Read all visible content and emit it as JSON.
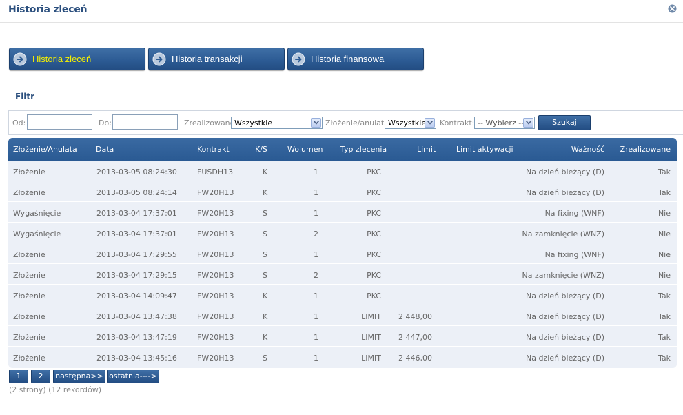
{
  "header": {
    "title": "Historia zleceń",
    "close_icon": "close-circle-icon"
  },
  "tabs": [
    {
      "label": "Historia zleceń",
      "active": true
    },
    {
      "label": "Historia transakcji",
      "active": false
    },
    {
      "label": "Historia finansowa",
      "active": false
    }
  ],
  "filter": {
    "title": "Filtr",
    "od_label": "Od:",
    "od_value": "",
    "do_label": "Do:",
    "do_value": "",
    "zrealizowane_label": "Zrealizowane",
    "zrealizowane_value": "Wszystkie",
    "zlozenie_label": "Złożenie/anulata",
    "zlozenie_value": "Wszystkie",
    "kontrakt_label": "Kontrakt:",
    "kontrakt_value": "-- Wybierz --",
    "search_label": "Szukaj"
  },
  "table": {
    "columns": [
      "Złożenie/Anulata",
      "Data",
      "Kontrakt",
      "K/S",
      "Wolumen",
      "Typ zlecenia",
      "Limit",
      "Limit aktywacji",
      "Ważność",
      "Zrealizowane"
    ],
    "rows": [
      [
        "Złożenie",
        "2013-03-05 08:24:30",
        "FUSDH13",
        "K",
        "1",
        "PKC",
        "",
        "",
        "Na dzień bieżący (D)",
        "Tak"
      ],
      [
        "Złożenie",
        "2013-03-05 08:24:14",
        "FW20H13",
        "K",
        "1",
        "PKC",
        "",
        "",
        "Na dzień bieżący (D)",
        "Tak"
      ],
      [
        "Wygaśnięcie",
        "2013-03-04 17:37:01",
        "FW20H13",
        "S",
        "1",
        "PKC",
        "",
        "",
        "Na fixing (WNF)",
        "Nie"
      ],
      [
        "Wygaśnięcie",
        "2013-03-04 17:37:01",
        "FW20H13",
        "S",
        "2",
        "PKC",
        "",
        "",
        "Na zamknięcie (WNZ)",
        "Nie"
      ],
      [
        "Złożenie",
        "2013-03-04 17:29:55",
        "FW20H13",
        "S",
        "1",
        "PKC",
        "",
        "",
        "Na fixing (WNF)",
        "Nie"
      ],
      [
        "Złożenie",
        "2013-03-04 17:29:15",
        "FW20H13",
        "S",
        "2",
        "PKC",
        "",
        "",
        "Na zamknięcie (WNZ)",
        "Nie"
      ],
      [
        "Złożenie",
        "2013-03-04 14:09:47",
        "FW20H13",
        "K",
        "1",
        "PKC",
        "",
        "",
        "Na dzień bieżący (D)",
        "Tak"
      ],
      [
        "Złożenie",
        "2013-03-04 13:47:38",
        "FW20H13",
        "K",
        "1",
        "LIMIT",
        "2 448,00",
        "",
        "Na dzień bieżący (D)",
        "Tak"
      ],
      [
        "Złożenie",
        "2013-03-04 13:47:19",
        "FW20H13",
        "K",
        "1",
        "LIMIT",
        "2 447,00",
        "",
        "Na dzień bieżący (D)",
        "Tak"
      ],
      [
        "Złożenie",
        "2013-03-04 13:45:16",
        "FW20H13",
        "S",
        "1",
        "LIMIT",
        "2 446,00",
        "",
        "Na dzień bieżący (D)",
        "Tak"
      ]
    ]
  },
  "pagination": {
    "pages": [
      "1",
      "2"
    ],
    "next_label": "następna>>",
    "last_label": "ostatnia---->",
    "summary": "(2 strony) (12 rekordów)"
  },
  "colors": {
    "title": "#2b4f7e",
    "tab_bg": "#2d5c95",
    "active_tab_text": "#f6f000",
    "grid_bg": "#ecf0f7"
  }
}
